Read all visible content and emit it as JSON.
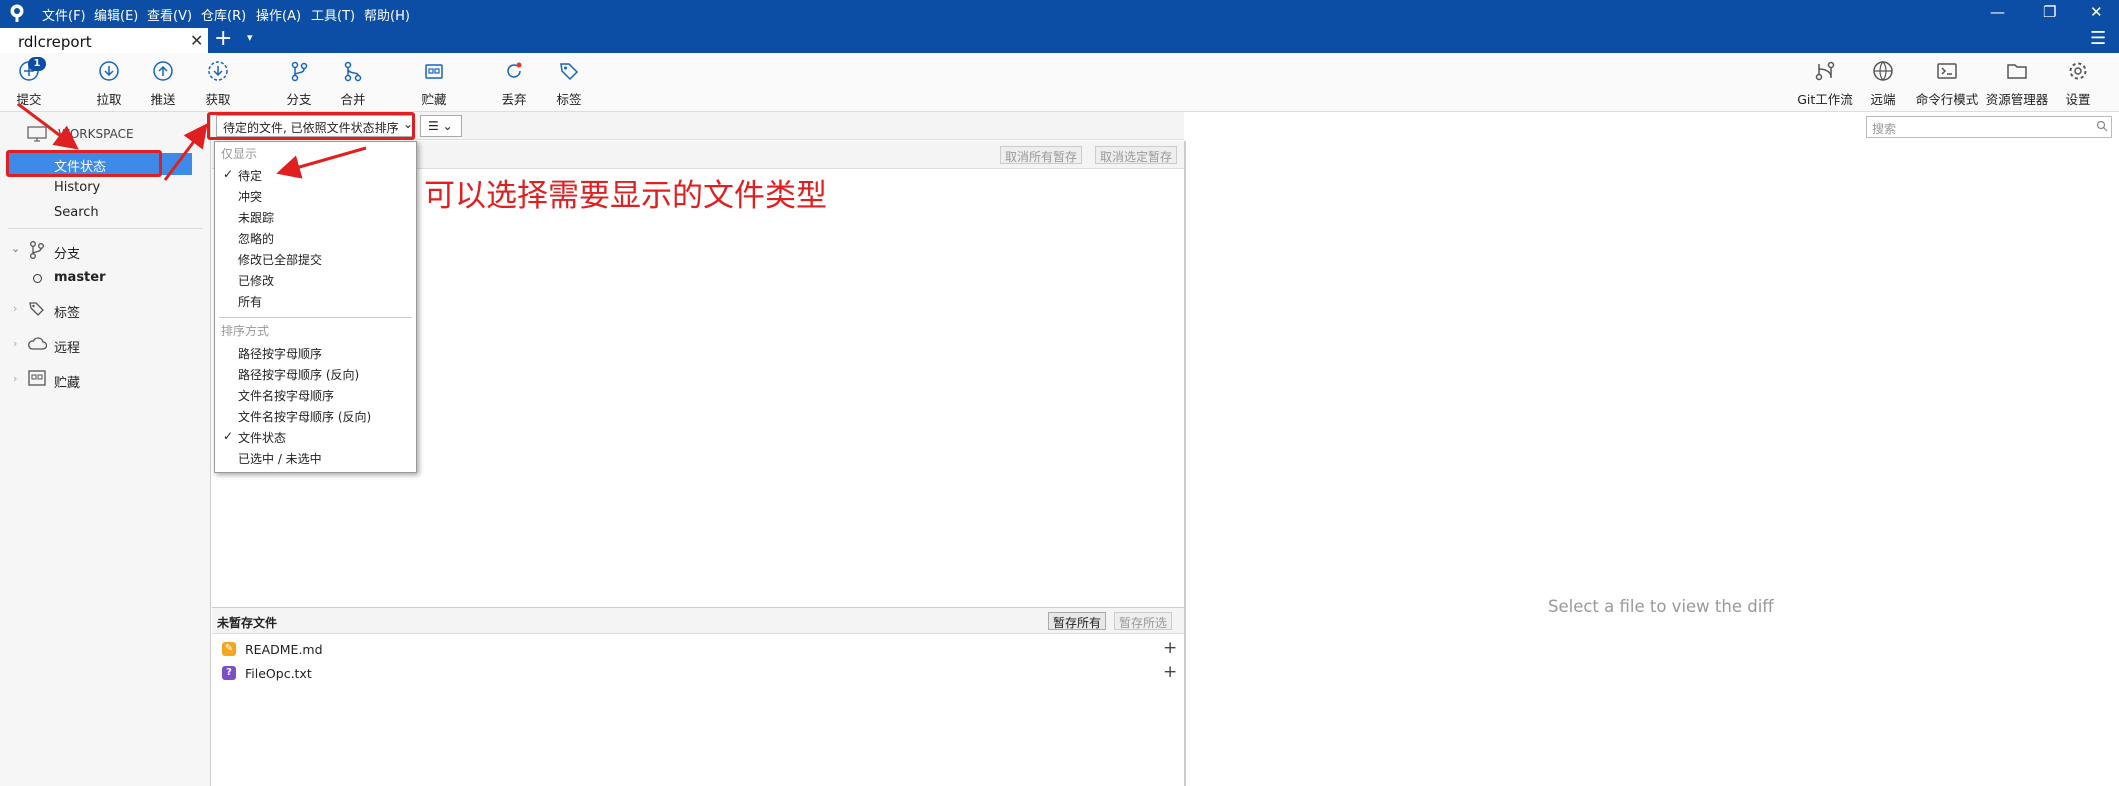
{
  "menubar": {
    "items": [
      "文件(F)",
      "编辑(E)",
      "查看(V)",
      "仓库(R)",
      "操作(A)",
      "工具(T)",
      "帮助(H)"
    ],
    "window_controls": [
      "—",
      "❐",
      "✕"
    ]
  },
  "tabbar": {
    "active_tab": "rdlcreport",
    "close": "✕",
    "new_tab": "+",
    "tab_dropdown": "▾",
    "menu": "☰"
  },
  "toolbar": {
    "left": [
      {
        "label": "提交",
        "icon": "commit-icon",
        "badge": "1"
      },
      {
        "label": "拉取",
        "icon": "pull-icon"
      },
      {
        "label": "推送",
        "icon": "push-icon"
      },
      {
        "label": "获取",
        "icon": "fetch-icon"
      },
      {
        "label": "分支",
        "icon": "branch-icon"
      },
      {
        "label": "合并",
        "icon": "merge-icon"
      },
      {
        "label": "贮藏",
        "icon": "stash-icon"
      },
      {
        "label": "丢弃",
        "icon": "discard-icon"
      },
      {
        "label": "标签",
        "icon": "tag-icon"
      }
    ],
    "right": [
      {
        "label": "Git工作流",
        "icon": "git-flow-icon"
      },
      {
        "label": "远端",
        "icon": "remote-icon"
      },
      {
        "label": "命令行模式",
        "icon": "terminal-icon"
      },
      {
        "label": "资源管理器",
        "icon": "explorer-icon"
      },
      {
        "label": "设置",
        "icon": "settings-icon"
      }
    ]
  },
  "sidebar": {
    "workspace_label": "WORKSPACE",
    "workspace_items": [
      "文件状态",
      "History",
      "Search"
    ],
    "branches_label": "分支",
    "current_branch": "master",
    "tags_label": "标签",
    "remotes_label": "远程",
    "stashes_label": "贮藏"
  },
  "filter": {
    "selected": "待定的文件, 已依照文件状态排序",
    "chevron": "⌄",
    "view_button": "☰ ⌄",
    "search_placeholder": "搜索"
  },
  "staged": {
    "unstage_all": "取消所有暂存",
    "unstage_selected": "取消选定暂存"
  },
  "unstaged": {
    "title": "未暂存文件",
    "stage_all": "暂存所有",
    "stage_selected": "暂存所选",
    "files": [
      {
        "name": "README.md",
        "status": "modified",
        "icon": "✎",
        "color": "#f2a621"
      },
      {
        "name": "FileOpc.txt",
        "status": "untracked",
        "icon": "?",
        "color": "#7a4fc7"
      }
    ]
  },
  "dropdown": {
    "show_header": "仅显示",
    "show_items": [
      {
        "label": "待定",
        "checked": true
      },
      {
        "label": "冲突",
        "checked": false
      },
      {
        "label": "未跟踪",
        "checked": false
      },
      {
        "label": "忽略的",
        "checked": false
      },
      {
        "label": "修改已全部提交",
        "checked": false
      },
      {
        "label": "已修改",
        "checked": false
      },
      {
        "label": "所有",
        "checked": false
      }
    ],
    "sort_header": "排序方式",
    "sort_items": [
      {
        "label": "路径按字母顺序",
        "checked": false
      },
      {
        "label": "路径按字母顺序 (反向)",
        "checked": false
      },
      {
        "label": "文件名按字母顺序",
        "checked": false
      },
      {
        "label": "文件名按字母顺序 (反向)",
        "checked": false
      },
      {
        "label": "文件状态",
        "checked": true
      },
      {
        "label": "已选中 / 未选中",
        "checked": false
      }
    ],
    "check": "✓"
  },
  "diff": {
    "empty_message": "Select a file to view the diff"
  },
  "annotation": {
    "text": "可以选择需要显示的文件类型",
    "color": "#e02020"
  }
}
